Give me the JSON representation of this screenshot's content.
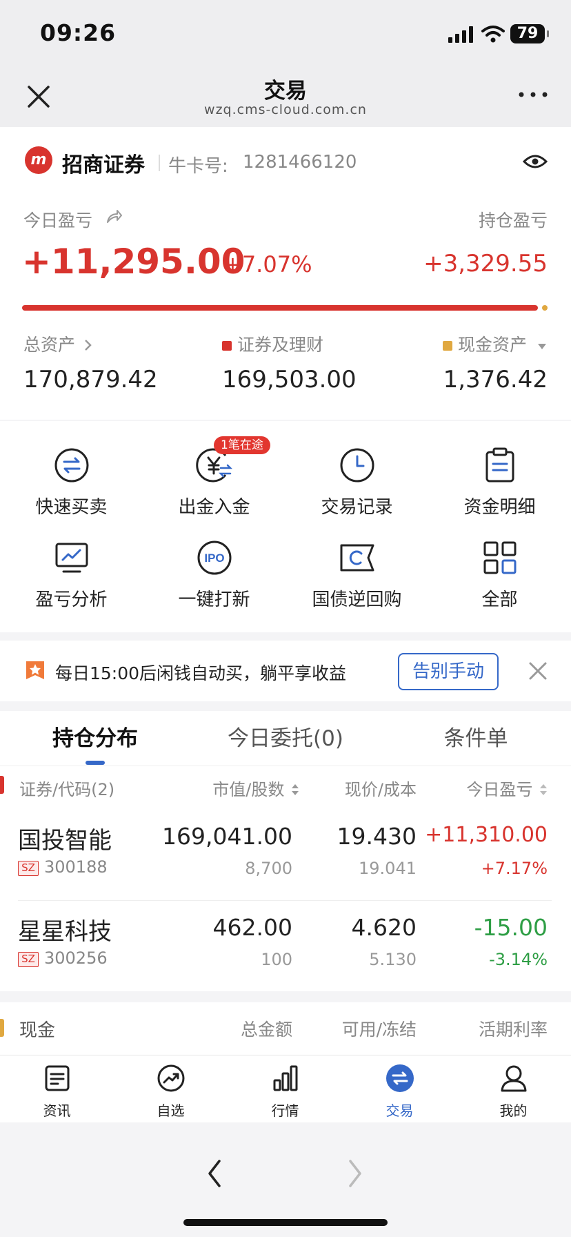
{
  "status_bar": {
    "time": "09:26",
    "battery": "79"
  },
  "nav": {
    "title": "交易",
    "url": "wzq.cms-cloud.com.cn"
  },
  "account": {
    "logo": "m",
    "broker": "招商证券",
    "card_label": "牛卡号:",
    "card_number": "1281466120"
  },
  "pnl": {
    "today_label": "今日盈亏",
    "today_amount": "+11,295.00",
    "today_pct": "+7.07%",
    "holding_label": "持仓盈亏",
    "holding_amount": "+3,329.55"
  },
  "assets": {
    "total_label": "总资产",
    "total_value": "170,879.42",
    "securities_label": "证券及理财",
    "securities_value": "169,503.00",
    "cash_label": "现金资产",
    "cash_value": "1,376.42"
  },
  "colors": {
    "up": "#d8342e",
    "down": "#2e9e45",
    "accent": "#3568c8",
    "cash": "#e0a840"
  },
  "quick_actions": [
    {
      "label": "快速买卖",
      "icon": "swap-circle-icon"
    },
    {
      "label": "出金入金",
      "icon": "yuan-transfer-icon"
    },
    {
      "label": "交易记录",
      "icon": "clock-icon"
    },
    {
      "label": "资金明细",
      "icon": "clipboard-icon"
    },
    {
      "label": "盈亏分析",
      "icon": "monitor-chart-icon"
    },
    {
      "label": "一键打新",
      "icon": "ipo-icon"
    },
    {
      "label": "国债逆回购",
      "icon": "ticket-icon"
    },
    {
      "label": "全部",
      "icon": "grid-icon"
    }
  ],
  "transfer_badge": "1笔在途",
  "promo": {
    "text": "每日15:00后闲钱自动买，躺平享收益",
    "button": "告别手动"
  },
  "tabs": [
    {
      "label": "持仓分布",
      "active": true
    },
    {
      "label": "今日委托(0)",
      "active": false
    },
    {
      "label": "条件单",
      "active": false
    }
  ],
  "holdings": {
    "headers": {
      "name": "证券/代码(2)",
      "value": "市值/股数",
      "price": "现价/成本",
      "pnl": "今日盈亏"
    },
    "rows": [
      {
        "name": "国投智能",
        "market": "SZ",
        "code": "300188",
        "value": "169,041.00",
        "shares": "8,700",
        "price": "19.430",
        "cost": "19.041",
        "pnl": "+11,310.00",
        "pnl_pct": "+7.17%",
        "direction": "up"
      },
      {
        "name": "星星科技",
        "market": "SZ",
        "code": "300256",
        "value": "462.00",
        "shares": "100",
        "price": "4.620",
        "cost": "5.130",
        "pnl": "-15.00",
        "pnl_pct": "-3.14%",
        "direction": "down"
      }
    ]
  },
  "cash_section": {
    "name": "现金",
    "total": "总金额",
    "available": "可用/冻结",
    "rate": "活期利率"
  },
  "tabbar": [
    {
      "label": "资讯",
      "icon": "news-icon",
      "active": false
    },
    {
      "label": "自选",
      "icon": "trend-icon",
      "active": false
    },
    {
      "label": "行情",
      "icon": "bar-chart-icon",
      "active": false
    },
    {
      "label": "交易",
      "icon": "trade-icon",
      "active": true
    },
    {
      "label": "我的",
      "icon": "person-icon",
      "active": false
    }
  ]
}
